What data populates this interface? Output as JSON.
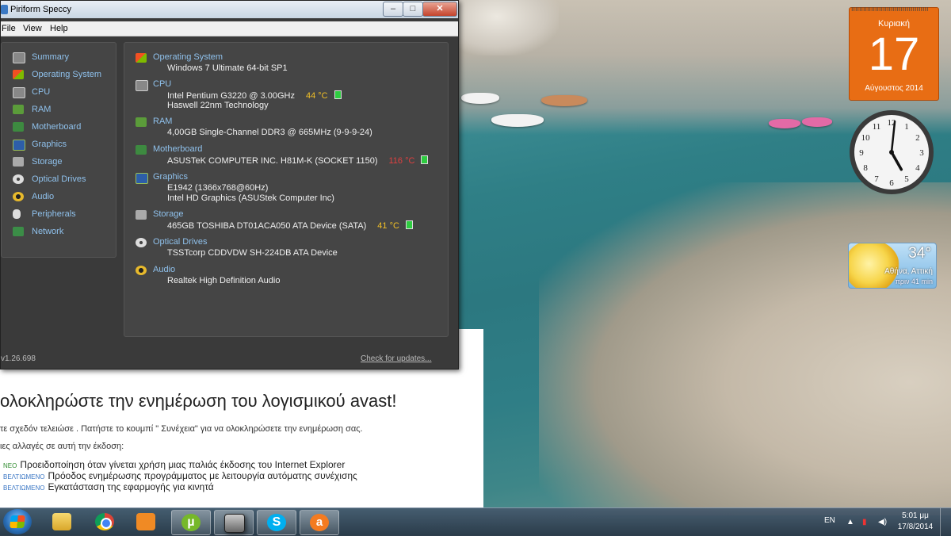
{
  "speccy": {
    "title": "Piriform Speccy",
    "controls": {
      "minimize": "–",
      "maximize": "□",
      "close": "✕"
    },
    "menu": [
      "File",
      "View",
      "Help"
    ],
    "sidebar": [
      {
        "label": "Summary",
        "icon": "summary-icon"
      },
      {
        "label": "Operating System",
        "icon": "windows-icon"
      },
      {
        "label": "CPU",
        "icon": "cpu-icon"
      },
      {
        "label": "RAM",
        "icon": "ram-icon"
      },
      {
        "label": "Motherboard",
        "icon": "motherboard-icon"
      },
      {
        "label": "Graphics",
        "icon": "monitor-icon"
      },
      {
        "label": "Storage",
        "icon": "hdd-icon"
      },
      {
        "label": "Optical Drives",
        "icon": "disc-icon"
      },
      {
        "label": "Audio",
        "icon": "speaker-icon"
      },
      {
        "label": "Peripherals",
        "icon": "mouse-icon"
      },
      {
        "label": "Network",
        "icon": "network-icon"
      }
    ],
    "summary": {
      "os": {
        "heading": "Operating System",
        "line1": "Windows 7 Ultimate 64-bit SP1"
      },
      "cpu": {
        "heading": "CPU",
        "line1": "Intel Pentium G3220 @ 3.00GHz",
        "temp": "44 °C",
        "line2": "Haswell 22nm Technology"
      },
      "ram": {
        "heading": "RAM",
        "line1": "4,00GB Single-Channel DDR3 @ 665MHz (9-9-9-24)"
      },
      "motherboard": {
        "heading": "Motherboard",
        "line1": "ASUSTeK COMPUTER INC. H81M-K (SOCKET 1150)",
        "temp": "116 °C"
      },
      "graphics": {
        "heading": "Graphics",
        "line1": "E1942 (1366x768@60Hz)",
        "line2": "Intel HD Graphics (ASUStek Computer Inc)"
      },
      "storage": {
        "heading": "Storage",
        "line1": "465GB TOSHIBA DT01ACA050 ATA Device (SATA)",
        "temp": "41 °C"
      },
      "optical": {
        "heading": "Optical Drives",
        "line1": "TSSTcorp CDDVDW SH-224DB ATA Device"
      },
      "audio": {
        "heading": "Audio",
        "line1": "Realtek High Definition Audio"
      }
    },
    "version": "v1.26.698",
    "check_updates": "Check for updates..."
  },
  "avast": {
    "heading": "ολοκληρώστε την ενημέρωση του λογισμικού avast!",
    "para1": "τε σχεδόν τελειώσε . Πατήστε το κουμπί \" Συνέχεια\" για να ολοκληρώσετε την ενημέρωση σας.",
    "para2": "ιες αλλαγές σε αυτή την έκδοση:",
    "items": [
      {
        "tag": "ΝΕΟ",
        "text": "Προειδοποίηση όταν γίνεται χρήση μιας παλιάς έκδοσης του Internet Explorer"
      },
      {
        "tag": "ΒΕΛΤΙΩΜΕΝΟ",
        "text": "Πρόοδος ενημέρωσης προγράμματος με λειτουργία αυτόματης συνέχισης"
      },
      {
        "tag": "ΒΕΛΤΙΩΜΕΝΟ",
        "text": "Εγκατάσταση της εφαρμογής για κινητά"
      }
    ]
  },
  "calendar": {
    "weekday": "Κυριακή",
    "day": "17",
    "month_year": "Αύγουστος 2014"
  },
  "clock": {
    "hour": 5,
    "minute": 1
  },
  "weather": {
    "temp": "34°",
    "city": "Αθήνα, Αττική",
    "updated": "πριν 41 min"
  },
  "taskbar": {
    "apps": [
      "explorer-icon",
      "chrome-icon",
      "media-player-icon",
      "utorrent-icon",
      "speccy-icon",
      "skype-icon",
      "avast-icon"
    ],
    "lang": "EN",
    "time": "5:01 μμ",
    "date": "17/8/2014"
  },
  "colors": {
    "accent_label": "#8fc1ec",
    "temp_ok": "#f2c027",
    "temp_hot": "#e04040",
    "calendar": "#e86d14"
  }
}
